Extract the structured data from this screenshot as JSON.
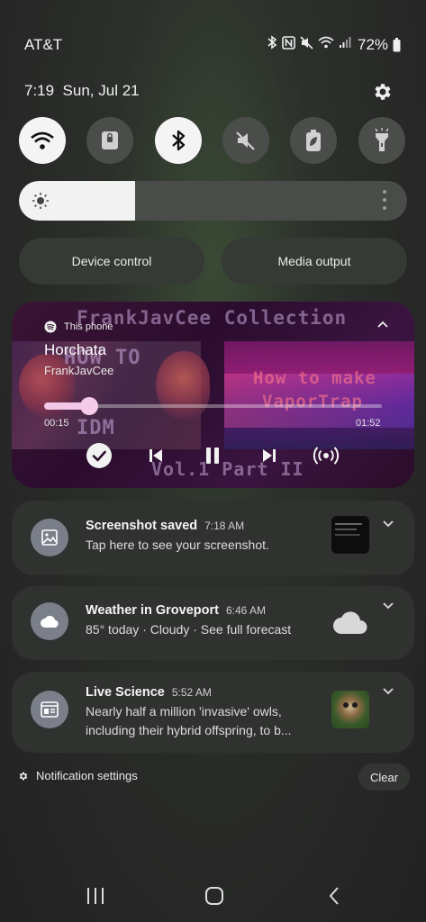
{
  "status_bar": {
    "carrier": "AT&T",
    "battery_percent": "72%",
    "icons": [
      "bluetooth-icon",
      "nfc-icon",
      "mute-icon",
      "wifi-icon",
      "signal-icon",
      "battery-icon"
    ]
  },
  "header": {
    "time": "7:19",
    "date": "Sun, Jul 21"
  },
  "quick_settings": {
    "toggles": [
      {
        "name": "wifi",
        "icon": "wifi-icon",
        "state": "on"
      },
      {
        "name": "screen-lock",
        "icon": "lock-icon",
        "state": "off"
      },
      {
        "name": "bluetooth",
        "icon": "bluetooth-icon",
        "state": "on"
      },
      {
        "name": "sound",
        "icon": "mute-icon",
        "state": "off"
      },
      {
        "name": "power-saving",
        "icon": "battery-leaf-icon",
        "state": "off"
      },
      {
        "name": "flashlight",
        "icon": "flashlight-icon",
        "state": "off"
      }
    ],
    "brightness_level": 0.3,
    "device_control_label": "Device control",
    "media_output_label": "Media output"
  },
  "media": {
    "source": "This phone",
    "title": "Horchata",
    "artist": "FrankJavCee",
    "elapsed": "00:15",
    "total": "01:52",
    "progress": 0.13,
    "album_art": {
      "title": "FrankJavCee Collection",
      "how_to": "HOW TO",
      "idm": "IDM",
      "volume": "Vol.1 Part II",
      "how_to_make": "How to make",
      "vaportrap": "VaporTrap"
    },
    "accent_color": "#f6cbe9"
  },
  "notifications": [
    {
      "app_icon": "image-icon",
      "title": "Screenshot saved",
      "time": "7:18 AM",
      "text": "Tap here to see your screenshot."
    },
    {
      "app_icon": "cloud-icon",
      "title": "Weather in Groveport",
      "time": "6:46 AM",
      "text": "85° today · Cloudy · See full forecast"
    },
    {
      "app_icon": "news-icon",
      "title": "Live Science",
      "time": "5:52 AM",
      "text": "Nearly half a million 'invasive' owls, including their hybrid offspring, to b..."
    }
  ],
  "footer": {
    "notification_settings": "Notification settings",
    "clear": "Clear"
  },
  "nav_bar": {
    "buttons": [
      "recents-icon",
      "home-icon",
      "back-icon"
    ]
  }
}
